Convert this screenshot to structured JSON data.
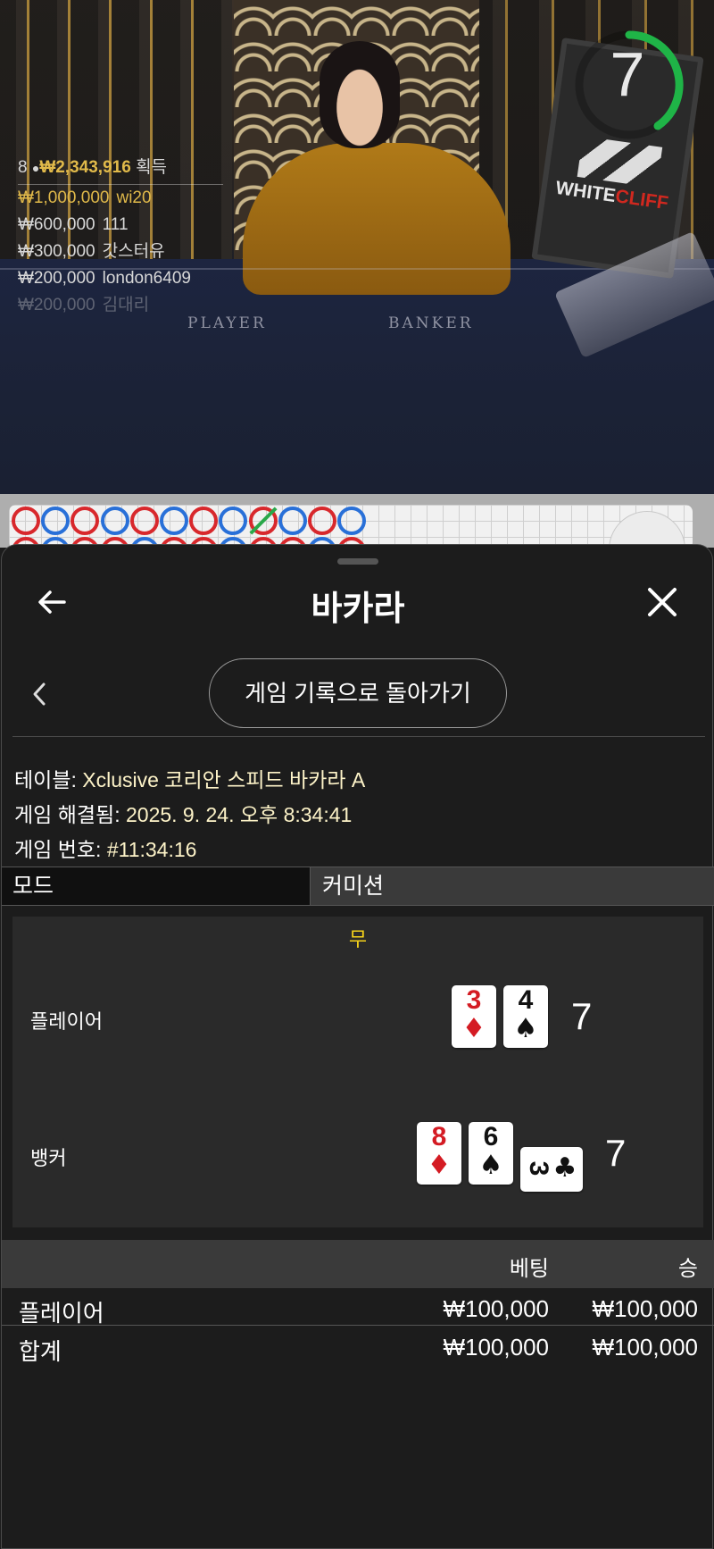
{
  "video": {
    "timer_value": "7",
    "table_labels": {
      "player": "PLAYER",
      "banker": "BANKER"
    },
    "sign": {
      "brand_a": "WHITE",
      "brand_b": "CLIFF"
    },
    "winners": {
      "count": "8",
      "total": "₩2,343,916",
      "label": "획득",
      "rows": [
        {
          "amount": "₩1,000,000",
          "name": "wi20"
        },
        {
          "amount": "₩600,000",
          "name": "111"
        },
        {
          "amount": "₩300,000",
          "name": "갓스터유"
        },
        {
          "amount": "₩200,000",
          "name": "london6409"
        },
        {
          "amount": "₩200,000",
          "name": "김대리"
        }
      ]
    }
  },
  "roadmap": {
    "beads_row1": [
      "B",
      "P",
      "B",
      "P",
      "B",
      "P",
      "B",
      "P",
      "B",
      "P",
      "B",
      "P"
    ],
    "tie_index": 8
  },
  "header": {
    "title": "바카라"
  },
  "back_to_history_label": "게임 기록으로 돌아가기",
  "info": {
    "table_label": "테이블:",
    "table_value": "Xclusive 코리안 스피드 바카라 A",
    "resolved_label": "게임 해결됨:",
    "resolved_value": "2025. 9. 24. 오후 8:34:41",
    "number_label": "게임 번호:",
    "number_value": "#11:34:16"
  },
  "mode": {
    "label": "모드",
    "value": "커미션"
  },
  "result": {
    "outcome": "무",
    "player": {
      "label": "플레이어",
      "cards": [
        {
          "rank": "3",
          "suit": "♦",
          "color": "red"
        },
        {
          "rank": "4",
          "suit": "♠",
          "color": "black"
        }
      ],
      "score": "7"
    },
    "banker": {
      "label": "뱅커",
      "cards": [
        {
          "rank": "8",
          "suit": "♦",
          "color": "red"
        },
        {
          "rank": "6",
          "suit": "♠",
          "color": "black"
        },
        {
          "rank": "3",
          "suit": "♣",
          "color": "black",
          "sideways": true
        }
      ],
      "score": "7"
    }
  },
  "bets": {
    "headers": {
      "bet": "베팅",
      "win": "승"
    },
    "rows": [
      {
        "name": "플레이어",
        "bet": "₩100,000",
        "win": "₩100,000"
      },
      {
        "name": "합계",
        "bet": "₩100,000",
        "win": "₩100,000"
      }
    ]
  },
  "colors": {
    "accent_gold": "#e0b94a",
    "tie_yellow": "#f5d21a",
    "banker_red": "#d8282c",
    "player_blue": "#2970d8",
    "timer_green": "#1fb447"
  }
}
